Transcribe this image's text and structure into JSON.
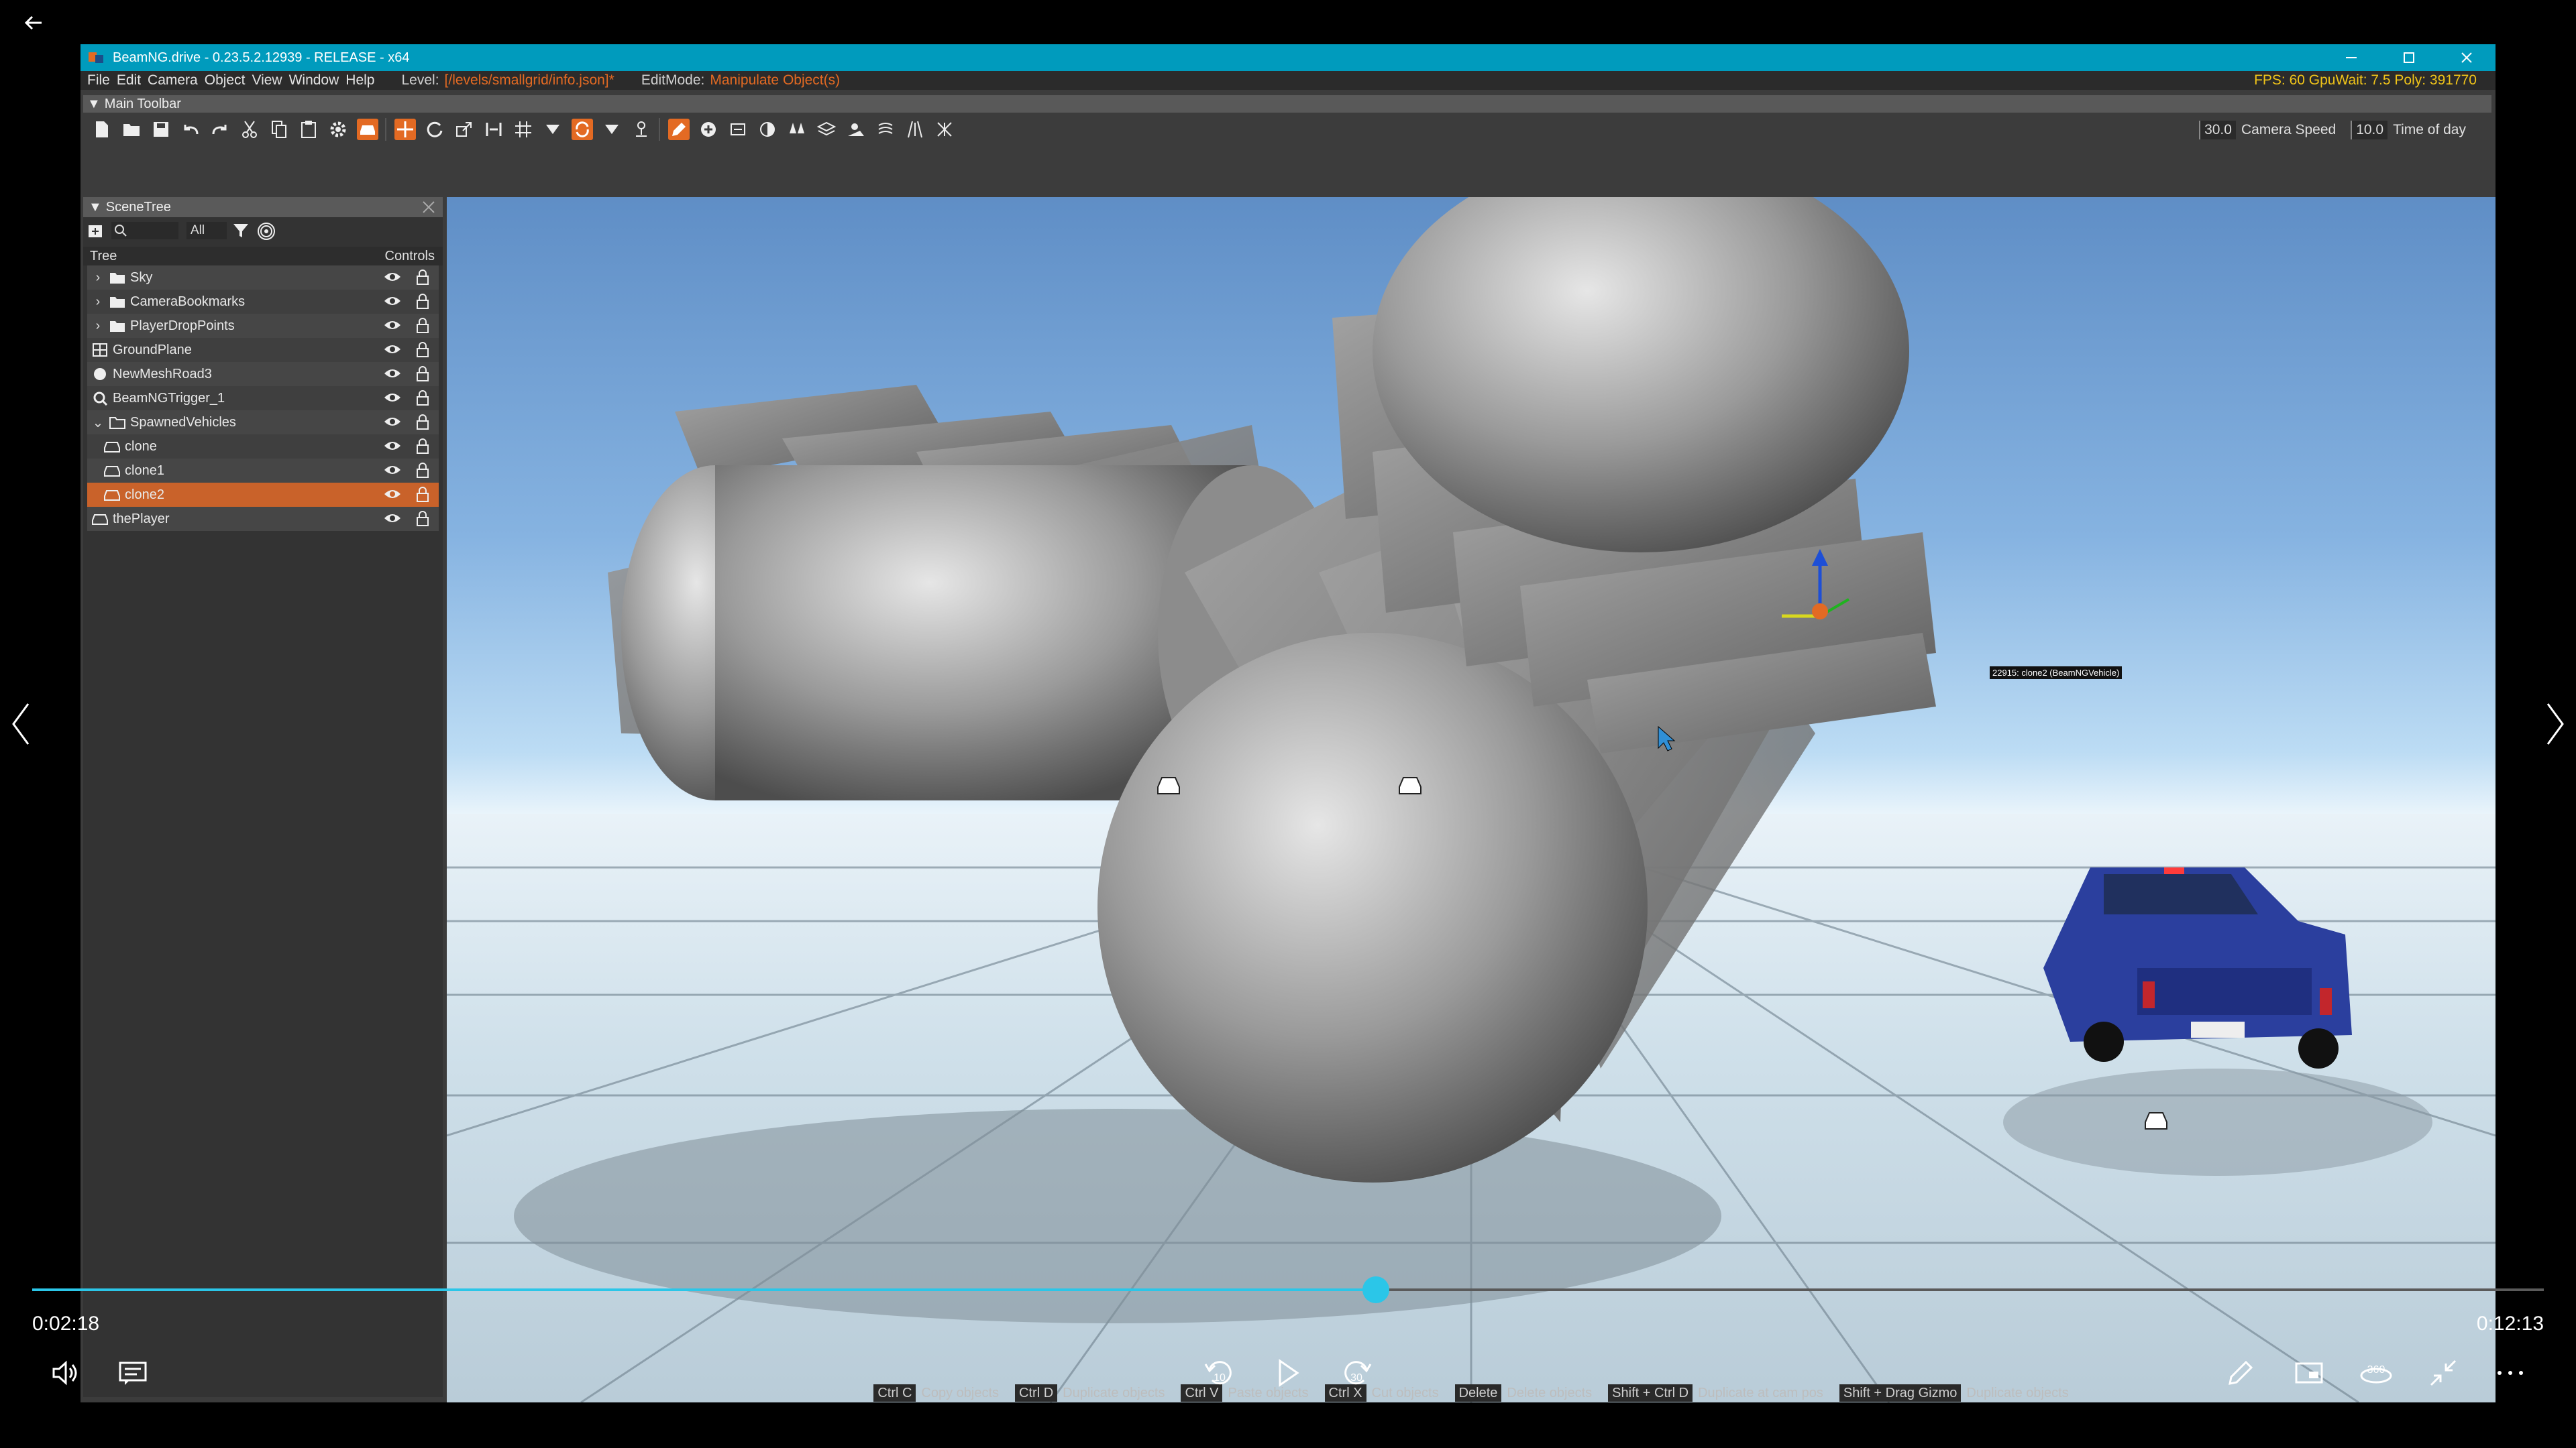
{
  "player": {
    "time_current": "0:02:18",
    "time_total": "0:12:13",
    "progress_fraction": 0.535,
    "skip_back_label": "10",
    "skip_forward_label": "30",
    "icons": [
      "back-arrow-icon",
      "volume-icon",
      "captions-icon",
      "rewind-10-icon",
      "play-icon",
      "forward-30-icon",
      "pen-icon",
      "picture-in-picture-icon",
      "360-icon",
      "exit-fullscreen-icon",
      "more-icon",
      "previous-icon",
      "next-icon"
    ],
    "accent_color": "#2bc6e8"
  },
  "app": {
    "title": "BeamNG.drive - 0.23.5.2.12939 - RELEASE - x64",
    "titlebar_color": "#009bbd",
    "menu": [
      "File",
      "Edit",
      "Camera",
      "Object",
      "View",
      "Window",
      "Help"
    ],
    "level_label": "Level:",
    "level_value": "[/levels/smallgrid/info.json]*",
    "editmode_label": "EditMode:",
    "editmode_value": "Manipulate Object(s)",
    "fps": "FPS: 60 GpuWait: 7.5 Poly: 391770",
    "accent_color": "#e36a23"
  },
  "main_toolbar": {
    "title": "Main Toolbar",
    "camera_speed_value": "30.0",
    "camera_speed_label": "Camera Speed",
    "time_of_day_value": "10.0",
    "time_of_day_label": "Time of day"
  },
  "scene_tree": {
    "title": "SceneTree",
    "filter_value": "All",
    "col_tree": "Tree",
    "col_controls": "Controls",
    "items": [
      {
        "label": "Sky",
        "icon": "folder-icon",
        "expandable": true
      },
      {
        "label": "CameraBookmarks",
        "icon": "folder-icon",
        "expandable": true
      },
      {
        "label": "PlayerDropPoints",
        "icon": "folder-icon",
        "expandable": true
      },
      {
        "label": "GroundPlane",
        "icon": "grid-icon",
        "expandable": false
      },
      {
        "label": "NewMeshRoad3",
        "icon": "circle-icon",
        "expandable": false
      },
      {
        "label": "BeamNGTrigger_1",
        "icon": "trigger-icon",
        "expandable": false
      },
      {
        "label": "SpawnedVehicles",
        "icon": "folder-open-icon",
        "expandable": true
      },
      {
        "label": "clone",
        "icon": "car-icon",
        "expandable": false
      },
      {
        "label": "clone1",
        "icon": "car-icon",
        "expandable": false
      },
      {
        "label": "clone2",
        "icon": "car-icon",
        "expandable": false,
        "selected": true
      },
      {
        "label": "thePlayer",
        "icon": "car-icon",
        "expandable": false
      }
    ]
  },
  "viewport": {
    "gizmo_label": "22915: clone2 (BeamNGVehicle)"
  },
  "hotkeys": [
    {
      "key": "Ctrl C",
      "label": "Copy objects"
    },
    {
      "key": "Ctrl D",
      "label": "Duplicate objects"
    },
    {
      "key": "Ctrl V",
      "label": "Paste objects"
    },
    {
      "key": "Ctrl X",
      "label": "Cut objects"
    },
    {
      "key": "Delete",
      "label": "Delete objects"
    },
    {
      "key": "Shift + Ctrl D",
      "label": "Duplicate at cam pos"
    },
    {
      "key": "Shift + Drag Gizmo",
      "label": "Duplicate objects"
    }
  ]
}
